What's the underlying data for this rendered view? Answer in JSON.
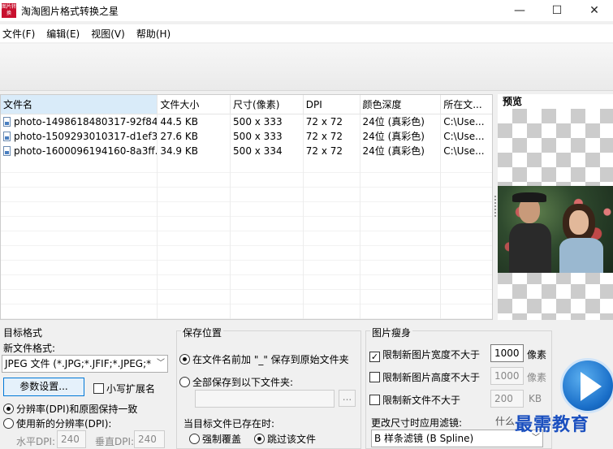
{
  "window": {
    "title": "淘淘图片格式转换之星",
    "icon_text": "图片转换",
    "controls": [
      "—",
      "☐",
      "✕"
    ]
  },
  "menu": [
    "文件(F)",
    "编辑(E)",
    "视图(V)",
    "帮助(H)"
  ],
  "file_list": {
    "columns": [
      "文件名",
      "文件大小",
      "尺寸(像素)",
      "DPI",
      "颜色深度",
      "所在文..."
    ],
    "rows": [
      [
        "photo-1498618480317-92f84...",
        "44.5 KB",
        "500 x 333",
        "72 x 72",
        "24位 (真彩色)",
        "C:\\Use..."
      ],
      [
        "photo-1509293010317-d1ef3...",
        "27.6 KB",
        "500 x 333",
        "72 x 72",
        "24位 (真彩色)",
        "C:\\Use..."
      ],
      [
        "photo-1600096194160-8a3ff...",
        "34.9 KB",
        "500 x 334",
        "72 x 72",
        "24位 (真彩色)",
        "C:\\Use..."
      ]
    ]
  },
  "preview": {
    "title": "预览"
  },
  "target_format": {
    "group_title": "目标格式",
    "new_format_label": "新文件格式:",
    "format_value": "JPEG 文件 (*.JPG;*.JFIF;*.JPEG;*",
    "params_button": "参数设置...",
    "lowercase_ext_label": "小写扩展名",
    "lowercase_ext_checked": false,
    "dpi_keep_label": "分辨率(DPI)和原图保持一致",
    "dpi_new_label": "使用新的分辨率(DPI):",
    "dpi_mode": "keep",
    "h_dpi_label": "水平DPI:",
    "h_dpi_value": "240",
    "v_dpi_label": "垂直DPI:",
    "v_dpi_value": "240"
  },
  "save_location": {
    "group_title": "保存位置",
    "option_prefix_label": "在文件名前加 \"_\" 保存到原始文件夹",
    "option_folder_label": "全部保存到以下文件夹:",
    "selected": "prefix",
    "folder_value": "",
    "browse_label": "...",
    "exists_label": "当目标文件已存在时:",
    "overwrite_label": "强制覆盖",
    "skip_label": "跳过该文件",
    "exists_selected": "skip"
  },
  "resize": {
    "group_title": "图片瘦身",
    "limit_width_label": "限制新图片宽度不大于",
    "limit_width_checked": true,
    "limit_width_value": "1000",
    "limit_width_unit": "像素",
    "limit_height_label": "限制新图片高度不大于",
    "limit_height_checked": false,
    "limit_height_value": "1000",
    "limit_height_unit": "像素",
    "limit_size_label": "限制新文件不大于",
    "limit_size_checked": false,
    "limit_size_value": "200",
    "limit_size_unit": "KB",
    "filter_label": "更改尺寸时应用滤镜:",
    "filter_value": "B 样条滤镜 (B Spline)"
  },
  "watermark": {
    "small": "什么",
    "big": "最需教育"
  }
}
